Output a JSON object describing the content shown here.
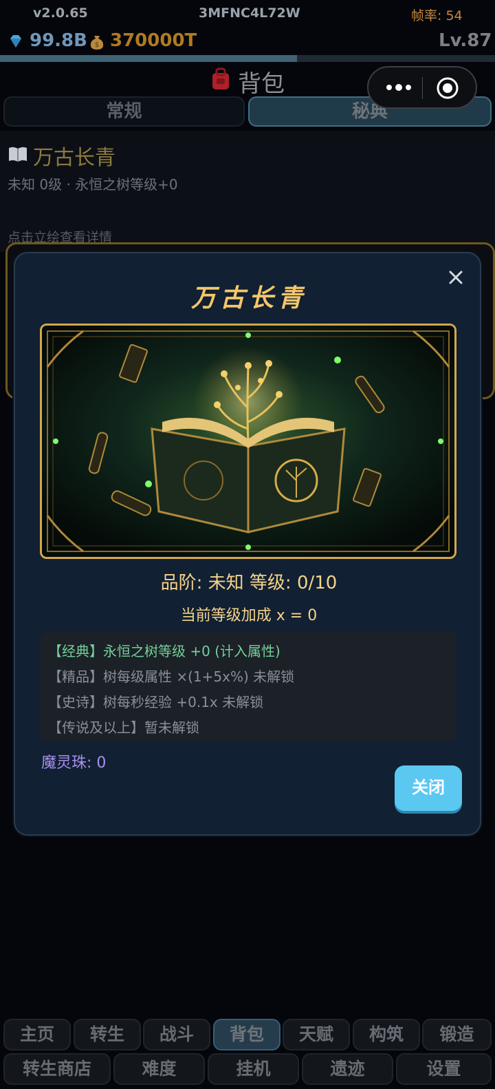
{
  "status": {
    "version": "v2.0.65",
    "uid": "3MFNC4L72W",
    "fps": "帧率: 54"
  },
  "resources": {
    "gems": "99.8B",
    "coins": "370000T",
    "level": "Lv.87",
    "exp_progress": 0.6
  },
  "page": {
    "title": "背包"
  },
  "tabs": [
    {
      "label": "常规"
    },
    {
      "label": "秘典"
    }
  ],
  "item": {
    "name": "万古长青",
    "subtitle": "未知 0级 · 永恒之树等级+0",
    "hint": "点击立绘查看详情"
  },
  "modal": {
    "title": "万古长青",
    "grade_line": "品阶: 未知   等级: 0/10",
    "bonus_line": "当前等级加成 x = 0",
    "effects": [
      "【经典】永恒之树等级 +0 (计入属性)",
      "【精品】树每级属性 ×(1+5x%) 未解锁",
      "【史诗】树每秒经验 +0.1x 未解锁",
      "【传说及以上】暂未解锁"
    ],
    "pearls": "魔灵珠: 0",
    "close_label": "关闭"
  },
  "nav_row1": [
    "主页",
    "转生",
    "战斗",
    "背包",
    "天赋",
    "构筑",
    "锻造"
  ],
  "nav_row2": [
    "转生商店",
    "难度",
    "挂机",
    "遗迹",
    "设置"
  ],
  "colors": {
    "accent_gold": "#f5c66a",
    "button_blue": "#5bc8f2",
    "classic_green": "#74d09a",
    "pearl_purple": "#a98ff2"
  }
}
